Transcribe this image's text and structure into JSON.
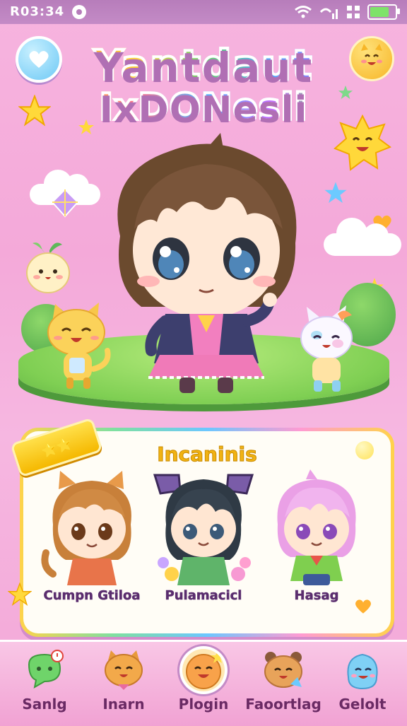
{
  "status_bar": {
    "time": "R03:34",
    "battery_level": 0.85,
    "icons": [
      "status-dot-icon",
      "wifi-icon",
      "signal-icon",
      "grid-icon",
      "battery-icon"
    ]
  },
  "header": {
    "title_line1": "Yantdaut",
    "title_line2": "IxDONesli",
    "left_button_icon": "heart-icon",
    "right_button_icon": "cat-face-icon"
  },
  "panel": {
    "ribbon_text": "⭐⭐",
    "title": "Incaninis",
    "characters": [
      {
        "name": "Cumpn Gtiloa",
        "hair": "#c8803a",
        "outfit": "#e8744a"
      },
      {
        "name": "Pulamacicl",
        "hair": "#2f3a45",
        "outfit": "#5fb46a"
      },
      {
        "name": "Hasag",
        "hair": "#eaa0e6",
        "outfit": "#7fcf4f"
      }
    ]
  },
  "bottom_nav": {
    "items": [
      {
        "label": "Sanlg",
        "icon": "chat-bubble-icon"
      },
      {
        "label": "Inarn",
        "icon": "tiger-face-icon"
      },
      {
        "label": "Plogin",
        "icon": "smiley-orb-icon"
      },
      {
        "label": "Faoortlag",
        "icon": "bear-face-icon"
      },
      {
        "label": "Gelolt",
        "icon": "blue-blob-icon"
      }
    ],
    "active_index": 2
  },
  "colors": {
    "background": "#f6b3dd",
    "status_bar": "#b77dbb",
    "panel_title": "#f1b312",
    "label_text": "#6a2a64"
  }
}
